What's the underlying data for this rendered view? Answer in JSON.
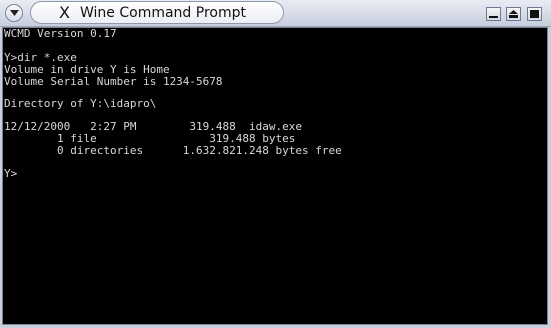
{
  "window": {
    "title": "Wine Command Prompt",
    "x_logo": "X"
  },
  "terminal": {
    "lines": [
      "WCMD Version 0.17",
      "",
      "Y>dir *.exe",
      "Volume in drive Y is Home",
      "Volume Serial Number is 1234-5678",
      "",
      "Directory of Y:\\idapro\\",
      "",
      "12/12/2000   2:27 PM        319.488  idaw.exe",
      "        1 file                 319.488 bytes",
      "        0 directories      1.632.821.248 bytes free",
      "",
      "Y>"
    ]
  },
  "colors": {
    "terminal_bg": "#000000",
    "terminal_fg": "#d8d8d8",
    "frame": "#c9cfdc"
  },
  "icons": {
    "menu": "chevron-down-icon",
    "minimize": "minimize-icon",
    "maximize": "maximize-icon",
    "close": "close-icon"
  }
}
